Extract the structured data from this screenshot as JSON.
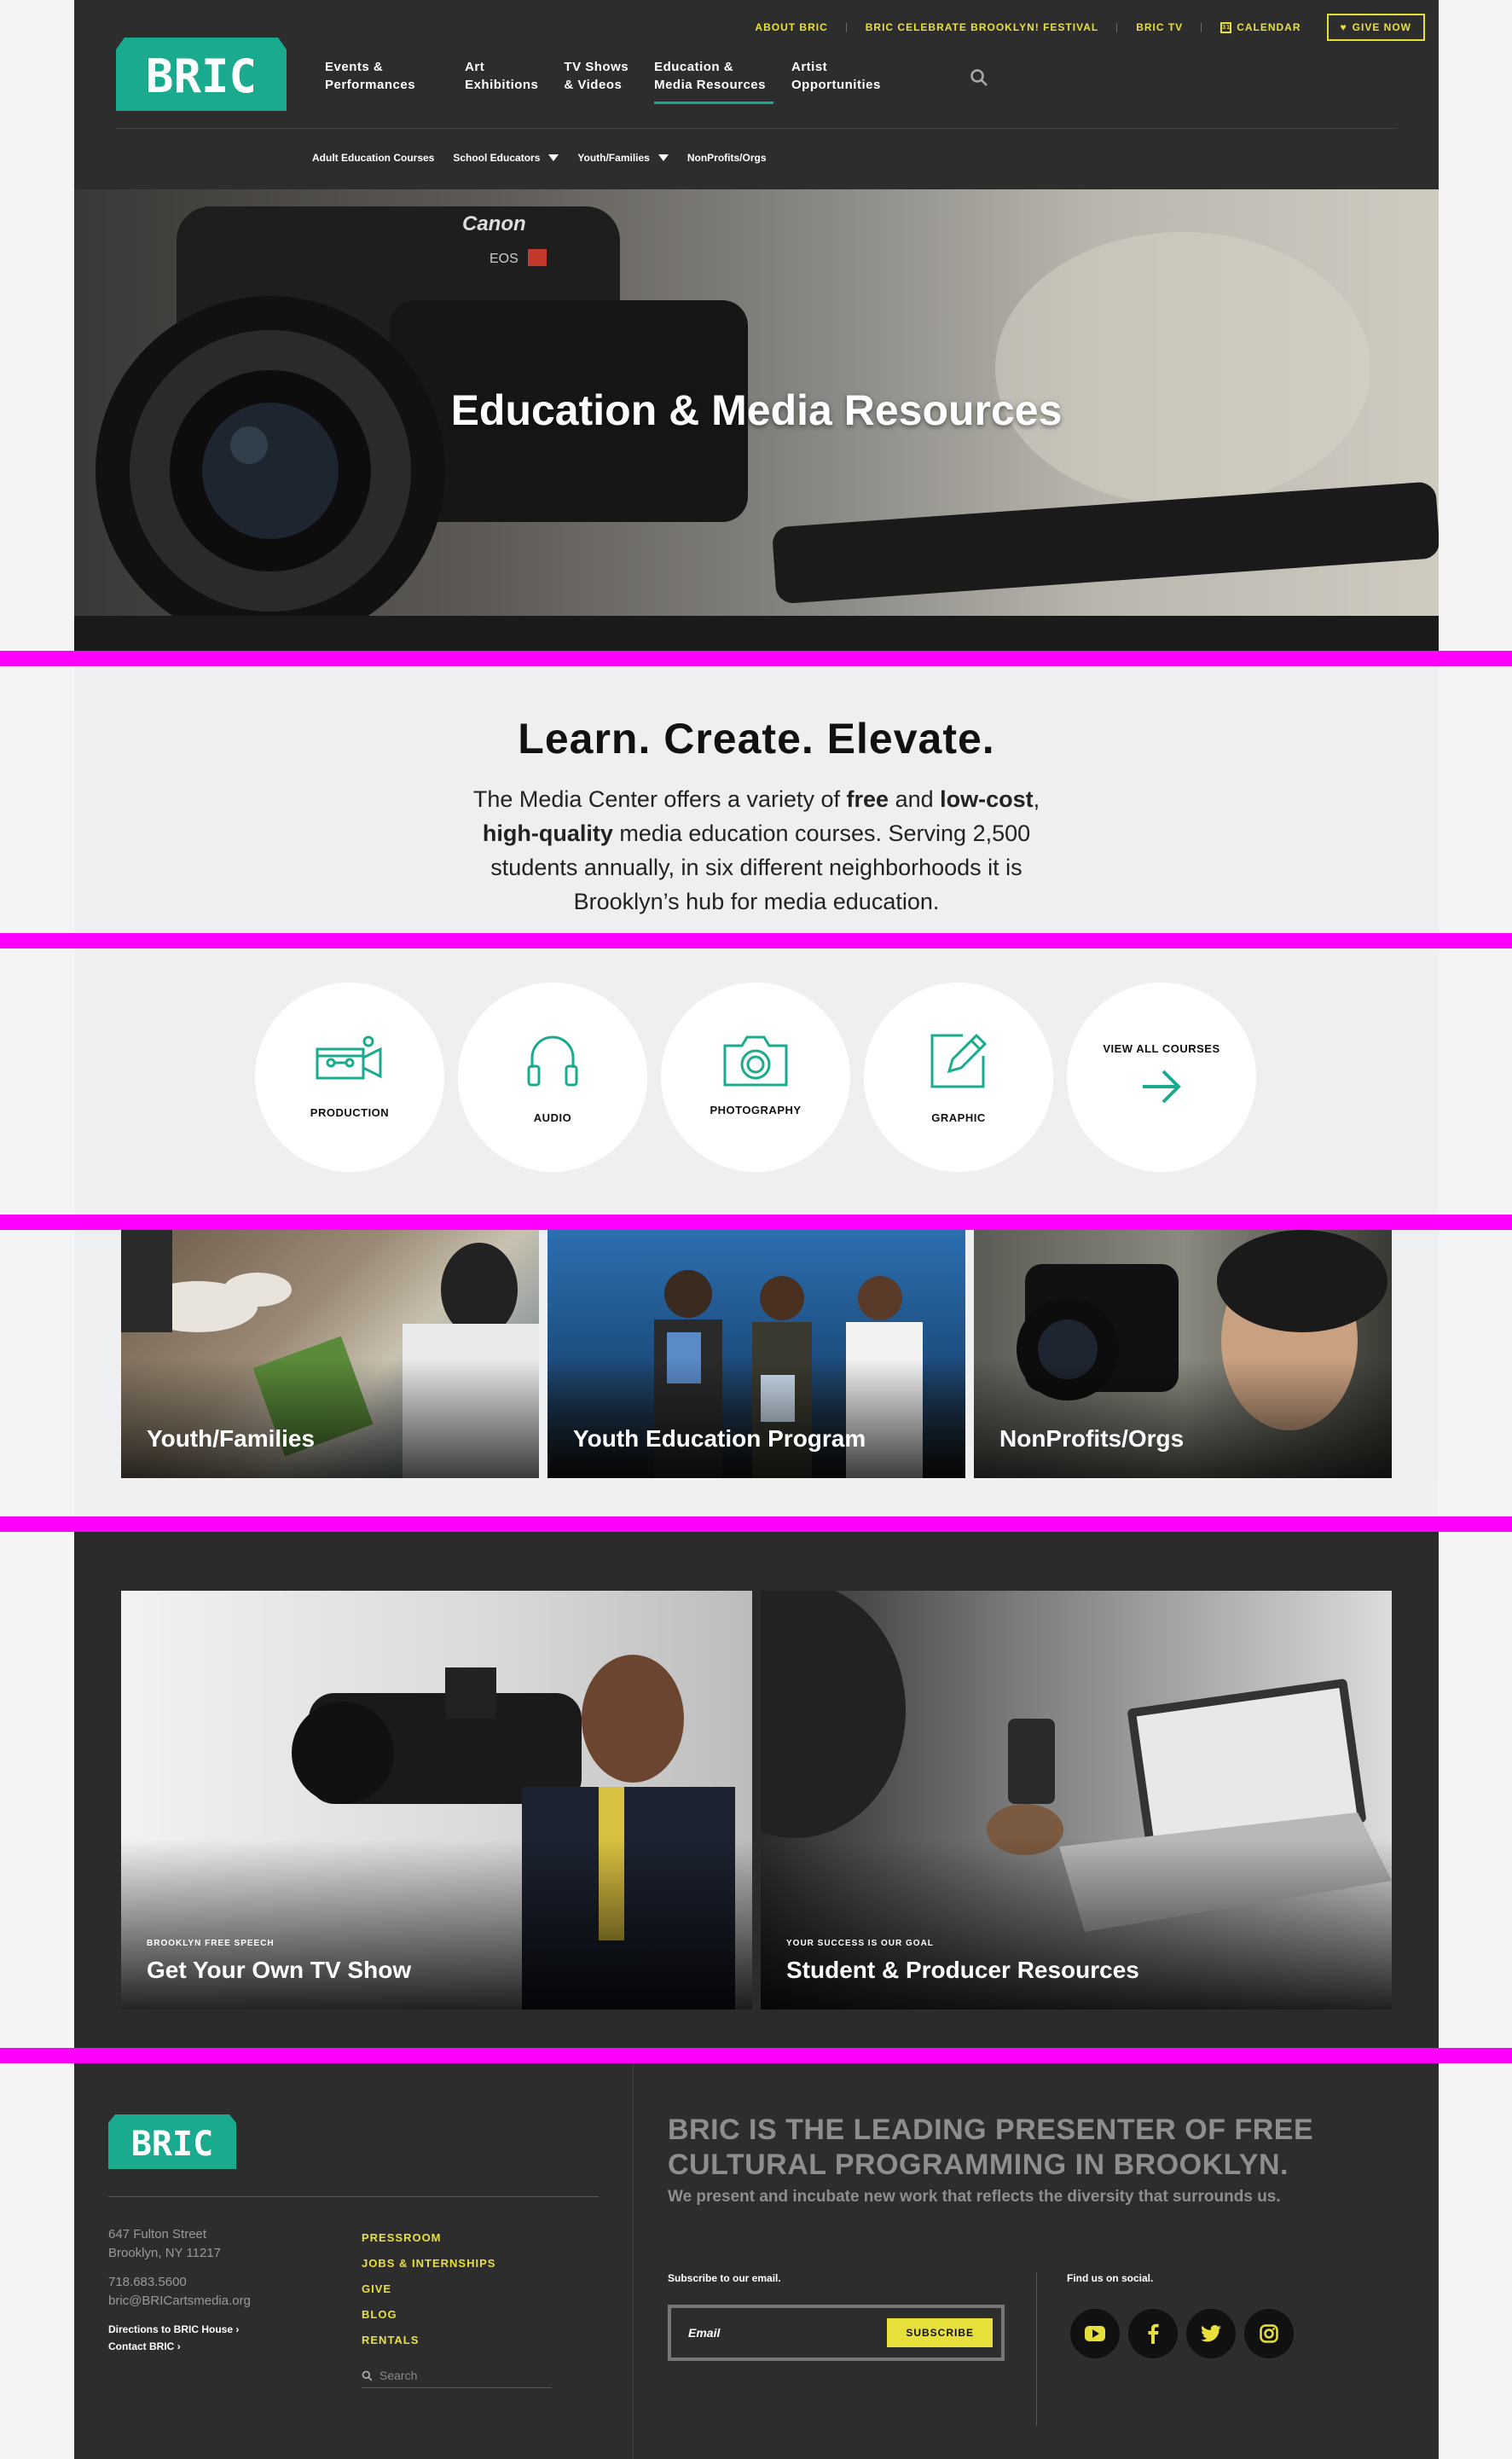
{
  "utility_nav": {
    "about": "ABOUT BRIC",
    "festival": "BRIC CELEBRATE BROOKLYN! FESTIVAL",
    "tv": "BRIC TV",
    "calendar": "CALENDAR",
    "calendar_icon_text": "31",
    "give": "GIVE NOW"
  },
  "logo": {
    "text": "BRIC",
    "color": "#1aaa8e"
  },
  "main_nav": [
    {
      "line1": "Events &",
      "line2": "Performances"
    },
    {
      "line1": "Art",
      "line2": "Exhibitions"
    },
    {
      "line1": "TV Shows",
      "line2": "& Videos"
    },
    {
      "line1": "Education &",
      "line2": "Media Resources"
    },
    {
      "line1": "Artist",
      "line2": "Opportunities"
    }
  ],
  "sub_nav": [
    "Adult Education Courses",
    "School Educators",
    "Youth/Families",
    "NonProfits/Orgs"
  ],
  "hero": {
    "title": "Education & Media Resources"
  },
  "intro": {
    "heading": "Learn. Create. Elevate.",
    "p1": "The Media Center offers a variety of ",
    "b1": "free",
    "p2": " and ",
    "b2": "low-cost",
    "p3": ", ",
    "b3": "high-quality",
    "p4": " media education courses. Serving 2,500 students annually, in six different neighborhoods it is Brooklyn’s hub for media education."
  },
  "courses": [
    {
      "label": "PRODUCTION",
      "icon": "video-camera-icon"
    },
    {
      "label": "AUDIO",
      "icon": "headphones-icon"
    },
    {
      "label": "PHOTOGRAPHY",
      "icon": "camera-icon"
    },
    {
      "label": "GRAPHIC",
      "icon": "pencil-icon"
    },
    {
      "label": "VIEW ALL COURSES",
      "icon": "arrow-right-icon"
    }
  ],
  "program_cards": [
    "Youth/Families",
    "Youth Education Program",
    "NonProfits/Orgs"
  ],
  "feature_cards": [
    {
      "kicker": "BROOKLYN FREE SPEECH",
      "title": "Get Your Own TV Show"
    },
    {
      "kicker": "YOUR SUCCESS IS OUR GOAL",
      "title": "Student & Producer Resources"
    }
  ],
  "footer": {
    "address1": "647 Fulton Street",
    "address2": "Brooklyn, NY 11217",
    "phone": "718.683.5600",
    "email": "bric@BRICartsmedia.org",
    "directions": "Directions to BRIC House",
    "contact": "Contact BRIC",
    "links": [
      "PRESSROOM",
      "JOBS & INTERNSHIPS",
      "GIVE",
      "BLOG",
      "RENTALS"
    ],
    "search_placeholder": "Search",
    "tagline": "BRIC IS THE LEADING PRESENTER OF FREE CULTURAL PROGRAMMING IN BROOKLYN.",
    "subline": "We present and incubate new work that reflects the diversity that surrounds us.",
    "subscribe_label": "Subscribe to our email.",
    "email_placeholder": "Email",
    "subscribe_button": "SUBSCRIBE",
    "social_label": "Find us on social.",
    "social": [
      "youtube-icon",
      "facebook-icon",
      "twitter-icon",
      "instagram-icon"
    ]
  },
  "colors": {
    "accent_yellow": "#e8e03a",
    "brand_green": "#1aaa8e",
    "header_bg": "#2d2d2d"
  }
}
